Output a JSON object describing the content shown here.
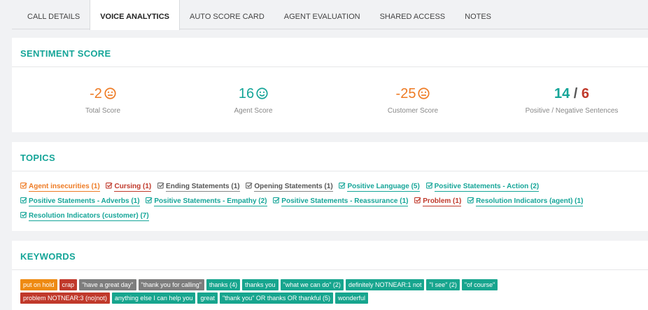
{
  "tabs": [
    {
      "label": "CALL DETAILS",
      "active": false
    },
    {
      "label": "VOICE ANALYTICS",
      "active": true
    },
    {
      "label": "AUTO SCORE CARD",
      "active": false
    },
    {
      "label": "AGENT EVALUATION",
      "active": false
    },
    {
      "label": "SHARED ACCESS",
      "active": false
    },
    {
      "label": "NOTES",
      "active": false
    }
  ],
  "sentiment": {
    "title": "SENTIMENT SCORE",
    "total": {
      "value": "-2",
      "label": "Total Score",
      "mood": "neutral"
    },
    "agent": {
      "value": "16",
      "label": "Agent Score",
      "mood": "happy"
    },
    "customer": {
      "value": "-25",
      "label": "Customer Score",
      "mood": "neutral"
    },
    "sentences": {
      "positive": "14",
      "separator": "/",
      "negative": "6",
      "label": "Positive / Negative Sentences"
    }
  },
  "topics": {
    "title": "TOPICS",
    "items": [
      {
        "label": "Agent insecurities (1)",
        "tone": "orange"
      },
      {
        "label": "Cursing (1)",
        "tone": "red"
      },
      {
        "label": "Ending Statements (1)",
        "tone": "gray"
      },
      {
        "label": "Opening Statements (1)",
        "tone": "gray"
      },
      {
        "label": "Positive Language (5)",
        "tone": "green"
      },
      {
        "label": "Positive Statements - Action (2)",
        "tone": "green"
      },
      {
        "label": "Positive Statements - Adverbs (1)",
        "tone": "green"
      },
      {
        "label": "Positive Statements - Empathy (2)",
        "tone": "green"
      },
      {
        "label": "Positive Statements - Reassurance (1)",
        "tone": "green"
      },
      {
        "label": "Problem (1)",
        "tone": "red"
      },
      {
        "label": "Resolution Indicators (agent) (1)",
        "tone": "green"
      },
      {
        "label": "Resolution Indicators (customer) (7)",
        "tone": "green"
      }
    ]
  },
  "keywords": {
    "title": "KEYWORDS",
    "rows": [
      [
        {
          "label": "put on hold",
          "tone": "orange"
        },
        {
          "label": "crap",
          "tone": "red"
        },
        {
          "label": "\"have a great day\"",
          "tone": "gray"
        },
        {
          "label": "\"thank you for calling\"",
          "tone": "gray"
        },
        {
          "label": "thanks (4)",
          "tone": "green"
        },
        {
          "label": "thanks you",
          "tone": "green"
        },
        {
          "label": "\"what we can do\" (2)",
          "tone": "green"
        },
        {
          "label": "definitely NOTNEAR:1 not",
          "tone": "green"
        },
        {
          "label": "\"I see\" (2)",
          "tone": "green"
        },
        {
          "label": "\"of course\"",
          "tone": "green"
        }
      ],
      [
        {
          "label": "problem NOTNEAR:3 (no|not)",
          "tone": "red"
        },
        {
          "label": "anything else I can help you",
          "tone": "green"
        },
        {
          "label": "great",
          "tone": "green"
        },
        {
          "label": "\"thank you\" OR thanks OR thankful (5)",
          "tone": "green"
        },
        {
          "label": "wonderful",
          "tone": "green"
        }
      ]
    ]
  }
}
